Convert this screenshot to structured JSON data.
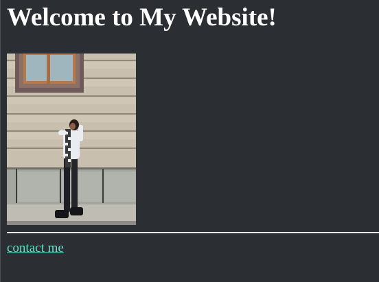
{
  "page": {
    "heading": "Welcome to My Website!",
    "link_label": "contact me"
  },
  "colors": {
    "background": "#2b2f33",
    "heading": "#ffffff",
    "link": "#66e0cc",
    "rule": "#f2f2f2"
  },
  "image": {
    "description_icon": "profile-photo"
  }
}
